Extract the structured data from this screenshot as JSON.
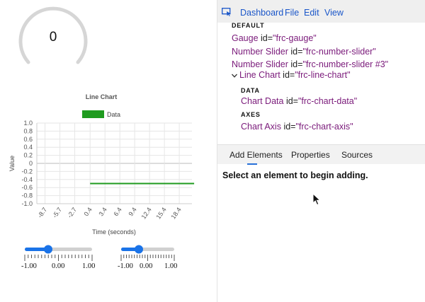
{
  "gauge": {
    "value": "0"
  },
  "chart_data": {
    "type": "line",
    "title": "Line Chart",
    "xlabel": "Time (seconds)",
    "ylabel": "Value",
    "ylim": [
      -1.0,
      1.0
    ],
    "yticks": [
      "1.0",
      "0.8",
      "0.6",
      "0.4",
      "0.2",
      "0",
      "-0.2",
      "-0.4",
      "-0.6",
      "-0.8",
      "-1.0"
    ],
    "xticks": [
      "-8.7",
      "-5.7",
      "-2.7",
      "0.4",
      "3.4",
      "6.4",
      "9.4",
      "12.4",
      "15.4",
      "18.4"
    ],
    "legend_position": "top",
    "grid": true,
    "series": [
      {
        "name": "Data",
        "color": "#1f9b1f",
        "x": [
          0.4,
          21.4
        ],
        "y": [
          -0.5,
          -0.5
        ]
      }
    ]
  },
  "sliders": [
    {
      "labels": [
        "-1.00",
        "0.00",
        "1.00"
      ],
      "value": -0.1,
      "accent": "#1a73e8"
    },
    {
      "labels": [
        "-1.00",
        "0.00",
        "1.00"
      ],
      "value": -0.1,
      "accent": "#1a73e8"
    }
  ],
  "menu": {
    "inspect_icon": "element-picker-icon",
    "items": [
      "Dashboard",
      "File",
      "Edit",
      "View"
    ]
  },
  "tree": {
    "default_label": "DEFAULT",
    "items": [
      {
        "tag": "Gauge",
        "attr": "id=",
        "value": "\"frc-gauge\""
      },
      {
        "tag": "Number Slider",
        "attr": "id=",
        "value": "\"frc-number-slider\""
      },
      {
        "tag": "Number Slider",
        "attr": "id=",
        "value": "\"frc-number-slider #3\""
      },
      {
        "tag": "Line Chart",
        "attr": "id=",
        "value": "\"frc-line-chart\""
      }
    ],
    "data_label": "DATA",
    "chart_data_item": {
      "tag": "Chart Data",
      "attr": "id=",
      "value": "\"frc-chart-data\""
    },
    "axes_label": "AXES",
    "chart_axis_item": {
      "tag": "Chart Axis",
      "attr": "id=",
      "value": "\"frc-chart-axis\""
    }
  },
  "tabs": [
    "Add Elements",
    "Properties",
    "Sources"
  ],
  "panel": {
    "message": "Select an element to begin adding."
  },
  "colors": {
    "link": "#1a56c9",
    "tag": "#7a1a7a",
    "accent": "#2870d8"
  }
}
